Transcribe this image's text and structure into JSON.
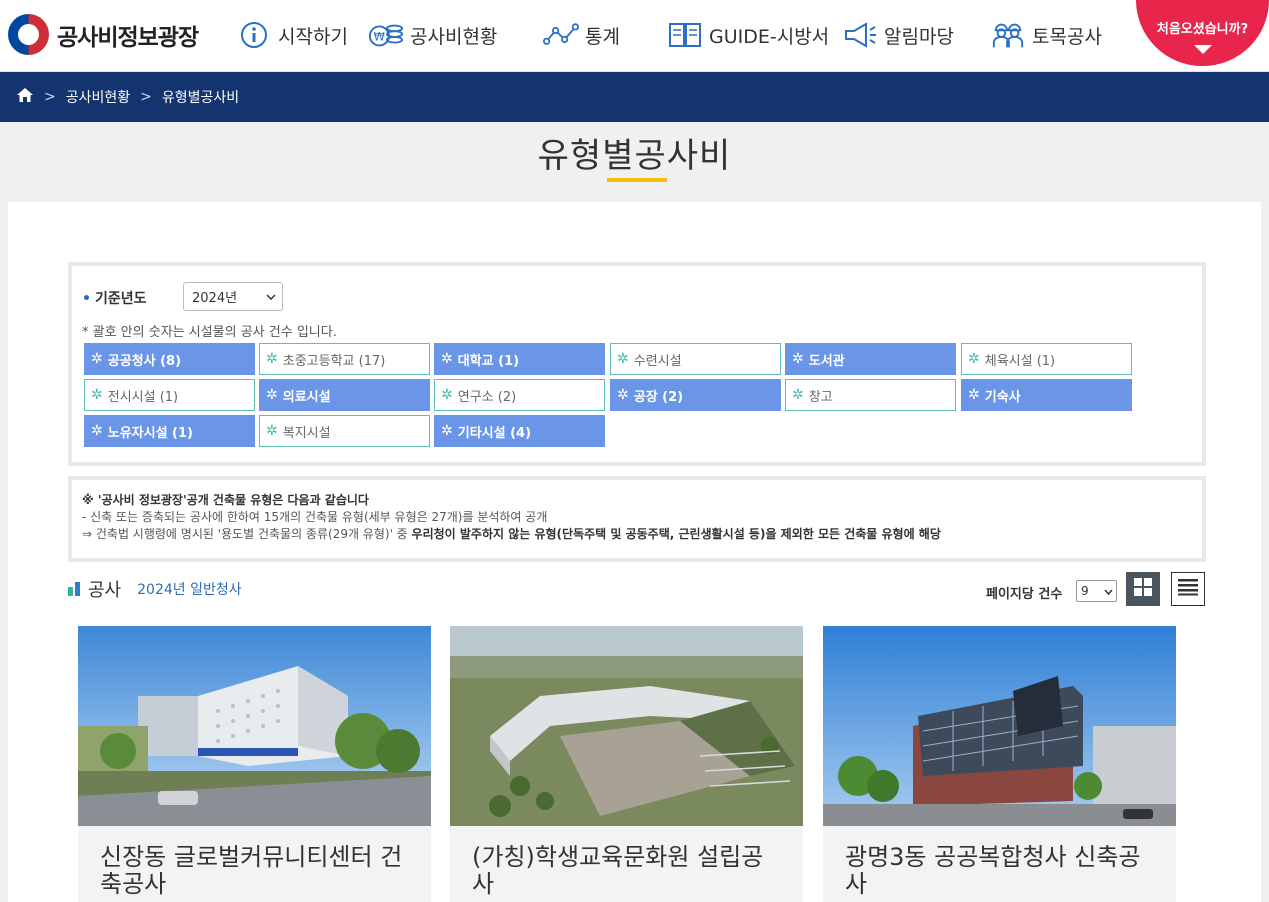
{
  "header": {
    "logo_text": "공사비정보광장",
    "nav": [
      {
        "label": "시작하기",
        "icon": "info-icon"
      },
      {
        "label": "공사비현황",
        "icon": "coins-icon"
      },
      {
        "label": "통계",
        "icon": "chart-line-icon"
      },
      {
        "label": "GUIDE-시방서",
        "icon": "book-icon"
      },
      {
        "label": "알림마당",
        "icon": "megaphone-icon"
      },
      {
        "label": "토목공사",
        "icon": "workers-icon"
      }
    ],
    "first_visit": "처음오셨습니까?"
  },
  "breadcrumb": {
    "home_icon": "home-icon",
    "items": [
      "공사비현황",
      "유형별공사비"
    ]
  },
  "page_title": "유형별공사비",
  "filter": {
    "year_label": "기준년도",
    "year_value": "2024년",
    "notice": "* 괄호 안의 숫자는 시설물의 공사 건수 입니다.",
    "categories": [
      {
        "label": "공공청사 (8)",
        "active": true
      },
      {
        "label": "초중고등학교 (17)",
        "active": false
      },
      {
        "label": "대학교 (1)",
        "active": true
      },
      {
        "label": "수련시설",
        "active": false
      },
      {
        "label": "도서관",
        "active": true
      },
      {
        "label": "체육시설 (1)",
        "active": false
      },
      {
        "label": "전시시설 (1)",
        "active": false
      },
      {
        "label": "의료시설",
        "active": true
      },
      {
        "label": "연구소 (2)",
        "active": false
      },
      {
        "label": "공장 (2)",
        "active": true
      },
      {
        "label": "창고",
        "active": false
      },
      {
        "label": "기숙사",
        "active": true
      },
      {
        "label": "노유자시설 (1)",
        "active": true
      },
      {
        "label": "복지시설",
        "active": false
      },
      {
        "label": "기타시설 (4)",
        "active": true
      }
    ]
  },
  "info": {
    "line1": "※ '공사비 정보광장'공개 건축물 유형은 다음과 같습니다",
    "line2": "- 신축 또는 증축되는 공사에 한하여 15개의 건축물 유형(세부 유형은 27개)를 분석하여 공개",
    "line3_a": "⇒ 건축법 시행령에 명시된 '용도별 건축물의 종류(29개 유형)' 중 ",
    "line3_b": "우리청이 발주하지 않는 유형(단독주택 및 공동주택, 근린생활시설 등)을 제외한 모든 건축물 유형에 해당"
  },
  "section": {
    "title": "공사",
    "subtitle": "2024년 일반청사",
    "perpage_label": "페이지당 건수",
    "perpage_value": "9"
  },
  "cards": [
    {
      "title": "신장동 글로벌커뮤니티센터 건축공사"
    },
    {
      "title": "(가칭)학생교육문화원 설립공사"
    },
    {
      "title": "광명3동 공공복합청사 신축공사"
    }
  ]
}
